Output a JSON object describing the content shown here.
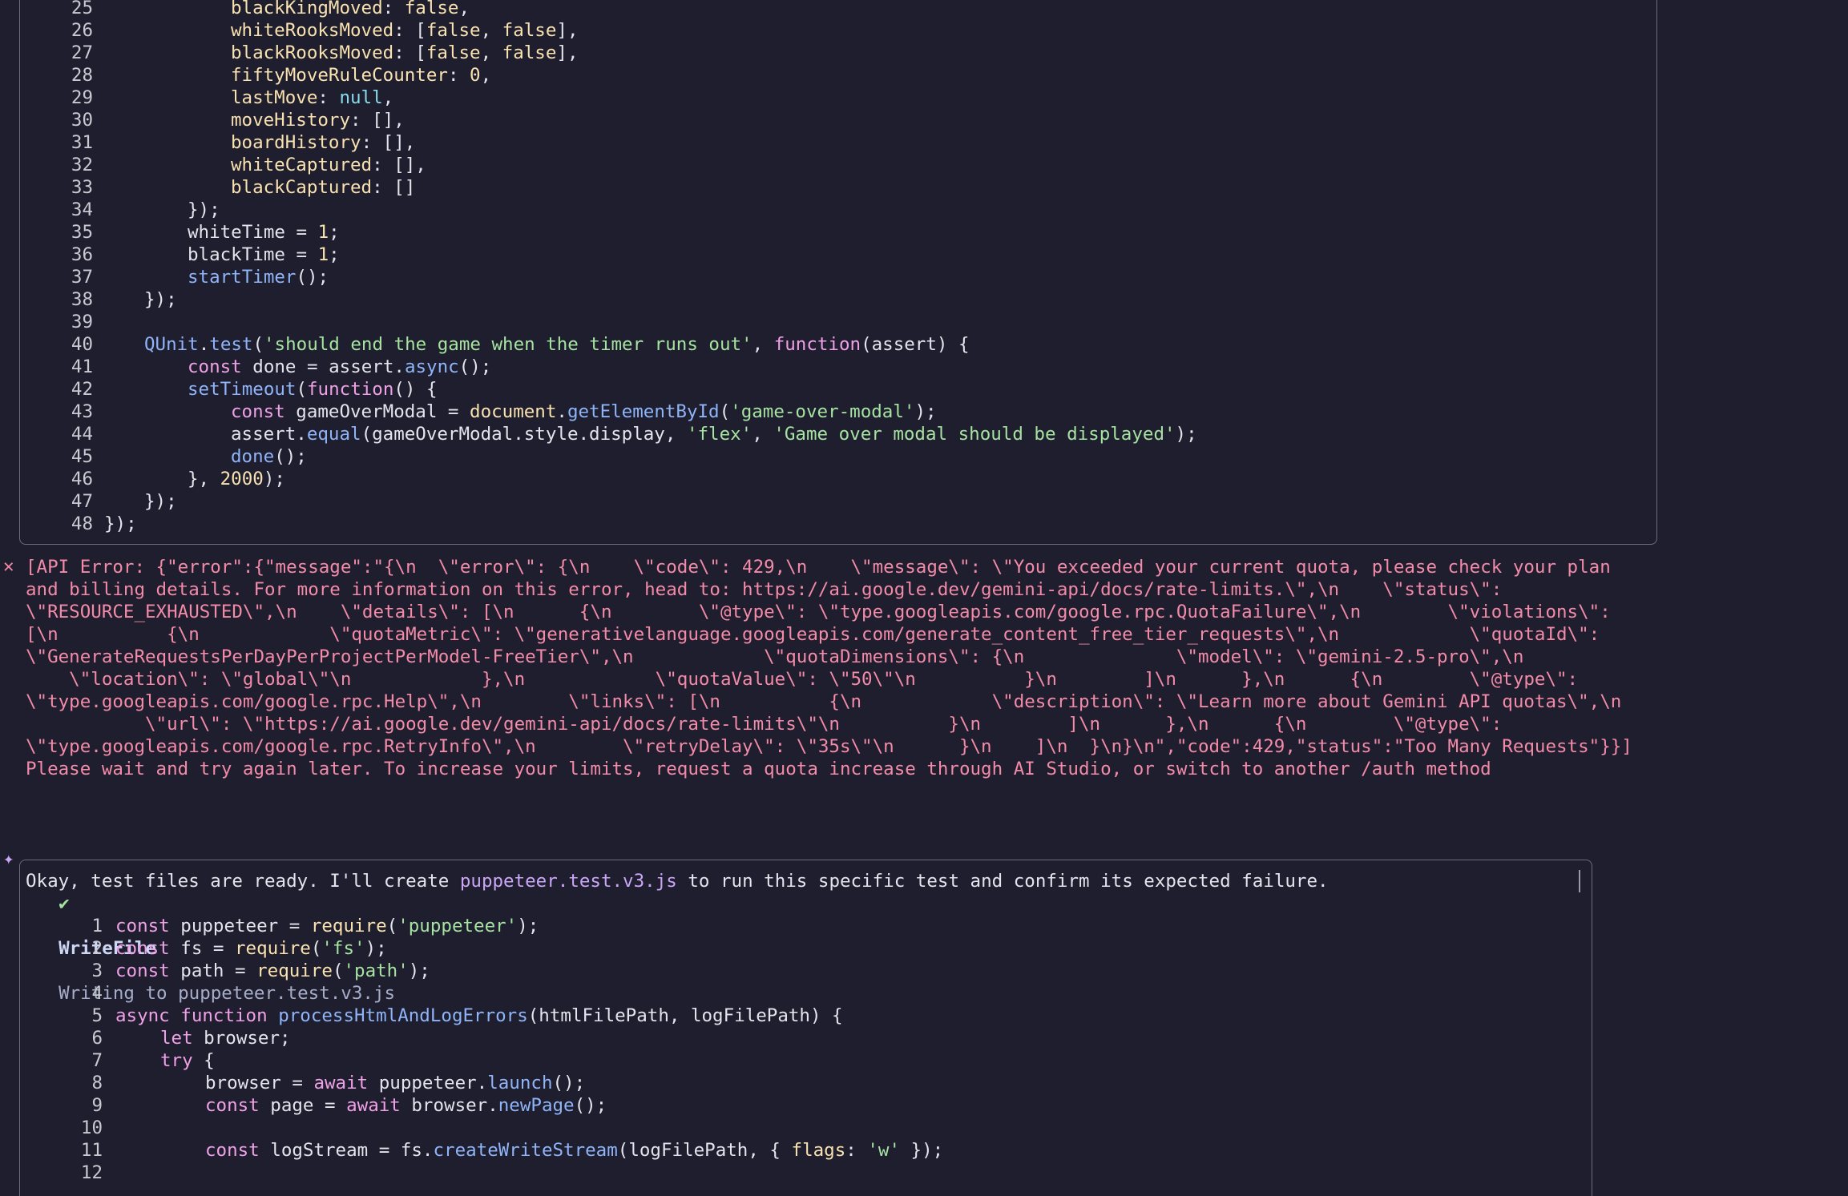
{
  "code_block_1": {
    "lines": [
      {
        "n": "25",
        "html": "<span style='padding-left:158px'></span><span class='pr'>blackKingMoved</span>: <span class='num'>false</span>,"
      },
      {
        "n": "26",
        "html": "<span style='padding-left:158px'></span><span class='pr'>whiteRooksMoved</span>: [<span class='num'>false</span>, <span class='num'>false</span>],"
      },
      {
        "n": "27",
        "html": "<span style='padding-left:158px'></span><span class='pr'>blackRooksMoved</span>: [<span class='num'>false</span>, <span class='num'>false</span>],"
      },
      {
        "n": "28",
        "html": "<span style='padding-left:158px'></span><span class='pr'>fiftyMoveRuleCounter</span>: <span class='num'>0</span>,"
      },
      {
        "n": "29",
        "html": "<span style='padding-left:158px'></span><span class='pr'>lastMove</span>: <span class='cy'>null</span>,"
      },
      {
        "n": "30",
        "html": "<span style='padding-left:158px'></span><span class='pr'>moveHistory</span>: [],"
      },
      {
        "n": "31",
        "html": "<span style='padding-left:158px'></span><span class='pr'>boardHistory</span>: [],"
      },
      {
        "n": "32",
        "html": "<span style='padding-left:158px'></span><span class='pr'>whiteCaptured</span>: [],"
      },
      {
        "n": "33",
        "html": "<span style='padding-left:158px'></span><span class='pr'>blackCaptured</span>: []"
      },
      {
        "n": "34",
        "html": "<span style='padding-left:104px'></span>});"
      },
      {
        "n": "35",
        "html": "<span style='padding-left:104px'></span>whiteTime = <span class='num'>1</span>;"
      },
      {
        "n": "36",
        "html": "<span style='padding-left:104px'></span>blackTime = <span class='num'>1</span>;"
      },
      {
        "n": "37",
        "html": "<span style='padding-left:104px'></span><span class='vl'>startTimer</span>();"
      },
      {
        "n": "38",
        "html": "<span style='padding-left:50px'></span>});"
      },
      {
        "n": "39",
        "html": ""
      },
      {
        "n": "40",
        "html": "<span style='padding-left:50px'></span><span class='vl'>QUnit</span>.<span class='vl'>test</span>(<span class='str'>'should end the game when the timer runs out'</span>, <span class='pl'>function</span>(assert) {"
      },
      {
        "n": "41",
        "html": "<span style='padding-left:104px'></span><span class='pl'>const</span> done = assert.<span class='vl'>async</span>();"
      },
      {
        "n": "42",
        "html": "<span style='padding-left:104px'></span><span class='vl'>setTimeout</span>(<span class='pl'>function</span>() {"
      },
      {
        "n": "43",
        "html": "<span style='padding-left:158px'></span><span class='pl'>const</span> gameOverModal = <span class='pr'>document</span>.<span class='vl'>getElementById</span>(<span class='str'>'game-over-modal'</span>);"
      },
      {
        "n": "44",
        "html": "<span style='padding-left:158px'></span>assert.<span class='vl'>equal</span>(gameOverModal.style.display, <span class='str'>'flex'</span>, <span class='str'>'Game over modal should be displayed'</span>);"
      },
      {
        "n": "45",
        "html": "<span style='padding-left:158px'></span><span class='vl'>done</span>();"
      },
      {
        "n": "46",
        "html": "<span style='padding-left:104px'></span>}, <span class='num'>2000</span>);"
      },
      {
        "n": "47",
        "html": "<span style='padding-left:50px'></span>});"
      },
      {
        "n": "48",
        "html": "});"
      }
    ]
  },
  "error": {
    "mark": "✕",
    "rows": [
      "[API Error: {\"error\":{\"message\":\"{\\n  \\\"error\\\": {\\n    \\\"code\\\": 429,\\n    \\\"message\\\": \\\"You exceeded your current quota, please check your plan",
      "and billing details. For more information on this error, head to: https://ai.google.dev/gemini-api/docs/rate-limits.\\\",\\n    \\\"status\\\":",
      "\\\"RESOURCE_EXHAUSTED\\\",\\n    \\\"details\\\": [\\n      {\\n        \\\"@type\\\": \\\"type.googleapis.com/google.rpc.QuotaFailure\\\",\\n        \\\"violations\\\":",
      "[\\n          {\\n            \\\"quotaMetric\\\": \\\"generativelanguage.googleapis.com/generate_content_free_tier_requests\\\",\\n            \\\"quotaId\\\":",
      "\\\"GenerateRequestsPerDayPerProjectPerModel-FreeTier\\\",\\n            \\\"quotaDimensions\\\": {\\n              \\\"model\\\": \\\"gemini-2.5-pro\\\",\\n",
      "    \\\"location\\\": \\\"global\\\"\\n            },\\n            \\\"quotaValue\\\": \\\"50\\\"\\n          }\\n        ]\\n      },\\n      {\\n        \\\"@type\\\":",
      "\\\"type.googleapis.com/google.rpc.Help\\\",\\n        \\\"links\\\": [\\n          {\\n            \\\"description\\\": \\\"Learn more about Gemini API quotas\\\",\\n",
      "           \\\"url\\\": \\\"https://ai.google.dev/gemini-api/docs/rate-limits\\\"\\n          }\\n        ]\\n      },\\n      {\\n        \\\"@type\\\":",
      "\\\"type.googleapis.com/google.rpc.RetryInfo\\\",\\n        \\\"retryDelay\\\": \\\"35s\\\"\\n      }\\n    ]\\n  }\\n}\\n\",\"code\":429,\"status\":\"Too Many Requests\"}}]",
      "Please wait and try again later. To increase your limits, request a quota increase through AI Studio, or switch to another /auth method"
    ]
  },
  "assistant_message": {
    "star": "✦",
    "before": "Okay, test files are ready. I'll create ",
    "filename": "puppeteer.test.v3.js",
    "after": " to run this specific test and confirm its expected failure."
  },
  "tool": {
    "check": "✔",
    "name": "WriteFile",
    "description": "Writing to puppeteer.test.v3.js"
  },
  "code_block_2": {
    "lines": [
      {
        "n": "1",
        "html": "<span class='pl'>const</span> puppeteer = <span class='num'>require</span>(<span class='str'>'puppeteer'</span>);"
      },
      {
        "n": "2",
        "html": "<span class='pl'>const</span> fs = <span class='num'>require</span>(<span class='str'>'fs'</span>);"
      },
      {
        "n": "3",
        "html": "<span class='pl'>const</span> path = <span class='num'>require</span>(<span class='str'>'path'</span>);"
      },
      {
        "n": "4",
        "html": ""
      },
      {
        "n": "5",
        "html": "<span class='pl'>async</span> <span class='pl'>function</span> <span class='vl'>processHtmlAndLogErrors</span>(htmlFilePath, logFilePath) {"
      },
      {
        "n": "6",
        "html": "<span style='padding-left:56px'></span><span class='pl'>let</span> browser;"
      },
      {
        "n": "7",
        "html": "<span style='padding-left:56px'></span><span class='pl'>try</span> {"
      },
      {
        "n": "8",
        "html": "<span style='padding-left:112px'></span>browser = <span class='pl'>await</span> puppeteer.<span class='vl'>launch</span>();"
      },
      {
        "n": "9",
        "html": "<span style='padding-left:112px'></span><span class='pl'>const</span> page = <span class='pl'>await</span> browser.<span class='vl'>newPage</span>();"
      },
      {
        "n": "10",
        "html": ""
      },
      {
        "n": "11",
        "html": "<span style='padding-left:112px'></span><span class='pl'>const</span> logStream = fs.<span class='vl'>createWriteStream</span>(logFilePath, { <span class='pr'>flags</span>: <span class='str'>'w'</span> });"
      },
      {
        "n": "12",
        "html": ""
      }
    ]
  }
}
